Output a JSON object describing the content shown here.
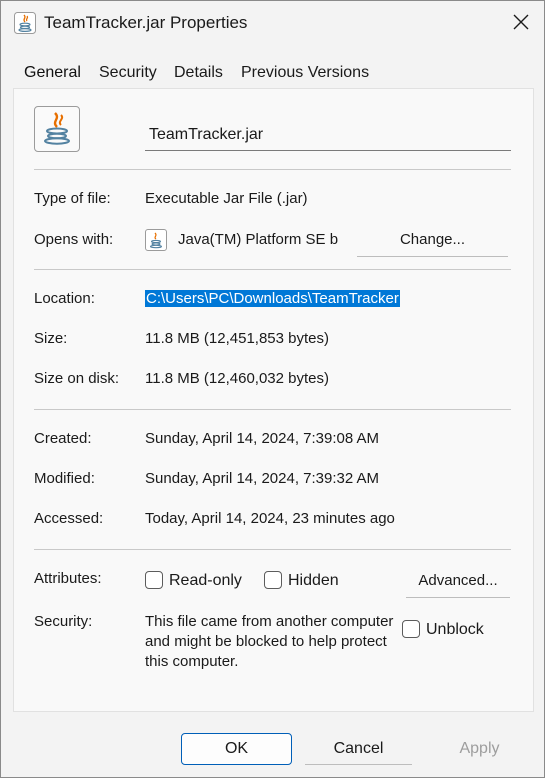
{
  "window": {
    "title": "TeamTracker.jar Properties",
    "icon": "java-icon",
    "close_icon": "close-icon"
  },
  "tabs": [
    {
      "label": "General",
      "active": true
    },
    {
      "label": "Security",
      "active": false
    },
    {
      "label": "Details",
      "active": false
    },
    {
      "label": "Previous Versions",
      "active": false
    }
  ],
  "general": {
    "file_name": "TeamTracker.jar",
    "type_label": "Type of file:",
    "type_value": "Executable Jar File (.jar)",
    "opens_label": "Opens with:",
    "opens_value": "Java(TM) Platform SE b",
    "change_button": "Change...",
    "location_label": "Location:",
    "location_value": "C:\\Users\\PC\\Downloads\\TeamTracker",
    "size_label": "Size:",
    "size_value": "11.8 MB (12,451,853 bytes)",
    "size_on_disk_label": "Size on disk:",
    "size_on_disk_value": "11.8 MB (12,460,032 bytes)",
    "created_label": "Created:",
    "created_value": "Sunday, April 14, 2024, 7:39:08 AM",
    "modified_label": "Modified:",
    "modified_value": "Sunday, April 14, 2024, 7:39:32 AM",
    "accessed_label": "Accessed:",
    "accessed_value": "Today, April 14, 2024, 23 minutes ago",
    "attributes_label": "Attributes:",
    "readonly_label": "Read-only",
    "readonly_checked": false,
    "hidden_label": "Hidden",
    "hidden_checked": false,
    "advanced_button": "Advanced...",
    "security_label": "Security:",
    "security_text": "This file came from another computer and might be blocked to help protect this computer.",
    "unblock_label": "Unblock",
    "unblock_checked": false
  },
  "footer": {
    "ok": "OK",
    "cancel": "Cancel",
    "apply": "Apply",
    "apply_enabled": false
  },
  "colors": {
    "selection": "#0078d7",
    "accent": "#005fb8",
    "disabled_text": "#9d9d9d"
  }
}
